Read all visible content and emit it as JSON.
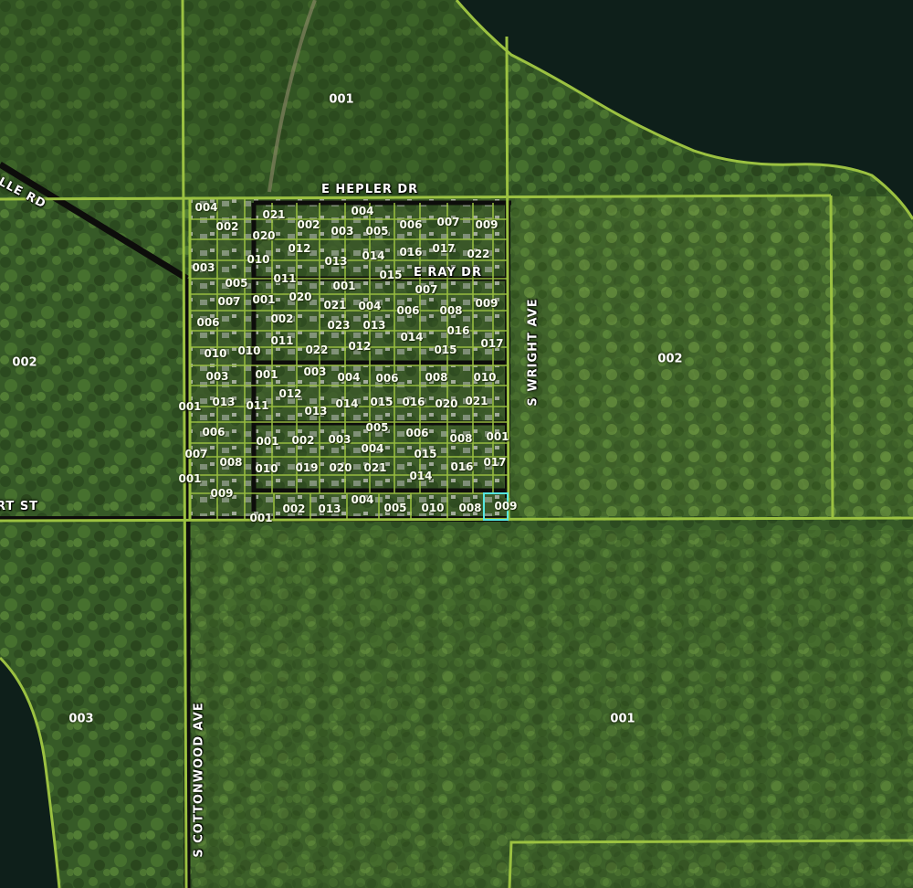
{
  "colors": {
    "forest_dark": "#24401c",
    "forest_light": "#4f7a32",
    "water": "#0e1f1a",
    "parcel_line": "#9bc141",
    "road": "#0d0d0b",
    "selection": "#55e6e0"
  },
  "streets": {
    "hepler": "E HEPLER DR",
    "ray": "E RAY DR",
    "wright": "S WRIGHT AVE",
    "cottonwood": "S COTTONWOOD AVE",
    "ille_rd": "ILLE RD",
    "rt_st": "RT ST"
  },
  "parcels": {
    "n_large": "001",
    "w_large": "002",
    "e_large": "002",
    "sw_large": "003",
    "s_large": "001",
    "lots": {
      "r1": [
        "004",
        "002",
        "021",
        "020",
        "002",
        "003",
        "004",
        "005",
        "006",
        "007",
        "009",
        "017",
        "022"
      ],
      "r2": [
        "003",
        "010",
        "012",
        "013",
        "014",
        "016",
        "015",
        "005",
        "011",
        "001",
        "007",
        "020",
        "001",
        "009"
      ],
      "r3": [
        "007",
        "001",
        "021",
        "004",
        "006",
        "008",
        "006",
        "002",
        "023",
        "013",
        "016",
        "014",
        "017"
      ],
      "r4": [
        "010",
        "010",
        "011",
        "022",
        "012",
        "015",
        "003",
        "001",
        "003",
        "004",
        "006",
        "008",
        "010"
      ],
      "r5": [
        "001",
        "013",
        "011",
        "012",
        "013",
        "014",
        "015",
        "016",
        "020",
        "021"
      ],
      "r6": [
        "006",
        "001",
        "002",
        "003",
        "005",
        "006",
        "008",
        "001",
        "007",
        "008",
        "004",
        "015",
        "017",
        "001"
      ],
      "r7": [
        "010",
        "019",
        "020",
        "021",
        "014",
        "016",
        "009",
        "002",
        "013",
        "004",
        "005",
        "010",
        "008",
        "009",
        "001"
      ]
    }
  }
}
